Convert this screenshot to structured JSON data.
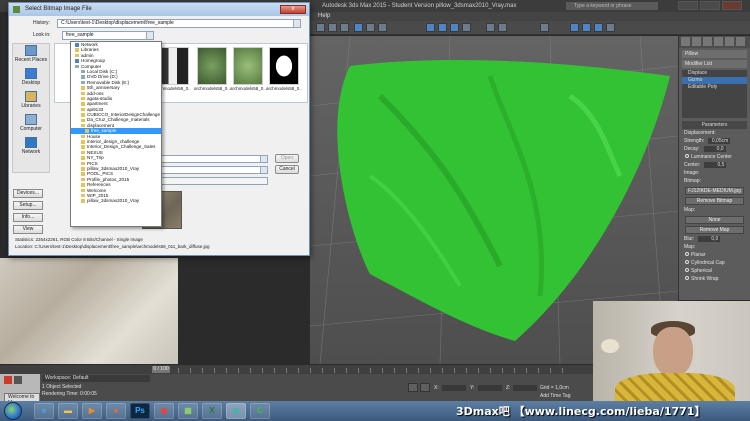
{
  "max": {
    "title": "Autodesk 3ds Max 2015 - Student Version   pillow_3dsmax2010_Vray.max",
    "search_placeholder": "Type a keyword or phrase",
    "menu": [
      "Help"
    ],
    "command_panel": {
      "object_name": "Pillow",
      "modifier_list": "Modifier List",
      "stack": [
        "Displace",
        "Gizmo",
        "Editable Poly"
      ],
      "rollout_title": "Parameters",
      "displacement_label": "Displacement:",
      "strength_label": "Strength:",
      "strength_value": "0,05cm",
      "decay_label": "Decay:",
      "decay_value": "0,0",
      "luminance_center": "Luminance Center",
      "center_label": "Center:",
      "center_value": "0,5",
      "image_label": "Image:",
      "bitmap_label": "Bitmap:",
      "bitmap_file": "FJ12IKDE-MEDIUM.jpg",
      "remove_bitmap": "Remove Bitmap",
      "map_label": "Map:",
      "map_none": "None",
      "remove_map": "Remove Map",
      "blur_label": "Blur:",
      "blur_value": "0,0",
      "map2_label": "Map:",
      "planar": "Planar",
      "cylindrical": "Cylindrical",
      "cap": "Cap",
      "spherical": "Spherical",
      "shrink_wrap": "Shrink Wrap"
    },
    "timeline": {
      "frame": "0 / 100"
    },
    "status": {
      "workspace": "Workspace: Default",
      "selected": "1 Object Selected",
      "render_time": "Rendering Time: 0:00:05",
      "x_label": "X:",
      "y_label": "Y:",
      "z_label": "Z:",
      "grid": "Grid = 1,0cm",
      "add_time_tag": "Add Time Tag",
      "welcome": "Welcome to M"
    }
  },
  "dialog": {
    "title": "Select Bitmap Image File",
    "close": "x",
    "history_label": "History:",
    "history_value": "C:\\Users\\test-1\\Desktop\\displacement\\free_sample",
    "lookin_label": "Look in:",
    "lookin_value": "free_sample",
    "places": [
      "Recent Places",
      "Desktop",
      "Libraries",
      "Computer",
      "Network"
    ],
    "thumbs": [
      "archmodels58_0...",
      "archmodels58_0...",
      "archmodels58_0...",
      "archmodels58_0..."
    ],
    "open": "Open",
    "cancel": "Cancel",
    "devices": "Devices...",
    "setup": "Setup...",
    "info": "Info...",
    "view": "View",
    "statistics_label": "Statistics:",
    "statistics_value": "2264x2261, RGB Color 8 Bits/Channel - Single Image",
    "location_label": "Location:",
    "location_value": "C:\\Users\\test-1\\Desktop\\displacement\\free_sample\\archmodels58_011_bark_diffuse.jpg",
    "tree": [
      {
        "label": "Network",
        "kind": "net"
      },
      {
        "label": "Libraries",
        "kind": "folder"
      },
      {
        "label": "admin",
        "kind": "folder"
      },
      {
        "label": "Homegroup",
        "kind": "net"
      },
      {
        "label": "Computer",
        "kind": "drv"
      },
      {
        "label": "Local Disk (C:)",
        "kind": "drv"
      },
      {
        "label": "DVD Drive (D:)",
        "kind": "drv"
      },
      {
        "label": "Removable Disk (E:)",
        "kind": "drv"
      },
      {
        "label": "5th_anniversary",
        "kind": "folder"
      },
      {
        "label": "add-ons",
        "kind": "folder"
      },
      {
        "label": "agata-studio",
        "kind": "folder"
      },
      {
        "label": "apartment",
        "kind": "folder"
      },
      {
        "label": "api9133",
        "kind": "folder"
      },
      {
        "label": "CUBICCO_InteriorDesignChallenge",
        "kind": "folder"
      },
      {
        "label": "Da_Cruz_Challenge_materials",
        "kind": "folder"
      },
      {
        "label": "displacement",
        "kind": "folder"
      },
      {
        "label": "free_sample",
        "kind": "folder",
        "state": "sel"
      },
      {
        "label": "House",
        "kind": "folder"
      },
      {
        "label": "interior_design_challenge",
        "kind": "folder"
      },
      {
        "label": "Interior_Design_Challenge_Sales",
        "kind": "folder"
      },
      {
        "label": "NEXUS",
        "kind": "folder"
      },
      {
        "label": "NY_Trip",
        "kind": "folder"
      },
      {
        "label": "PICS",
        "kind": "folder"
      },
      {
        "label": "pillow_3dsmax2010_Vray",
        "kind": "folder"
      },
      {
        "label": "POOL_PICS",
        "kind": "folder"
      },
      {
        "label": "Profile_photos_2015",
        "kind": "folder"
      },
      {
        "label": "References",
        "kind": "folder"
      },
      {
        "label": "Welcome",
        "kind": "folder"
      },
      {
        "label": "WIP_2015",
        "kind": "folder"
      },
      {
        "label": "pillow_3dsmax2010_Vray",
        "kind": "folder"
      }
    ]
  },
  "taskbar": {
    "items": [
      "ie",
      "folder",
      "media",
      "firefox",
      "photoshop",
      "chrome",
      "gallery",
      "excel",
      "3dsmax",
      "camtasia"
    ],
    "watermark": "3Dmax吧 【www.linecg.com/lieba/1771】"
  }
}
